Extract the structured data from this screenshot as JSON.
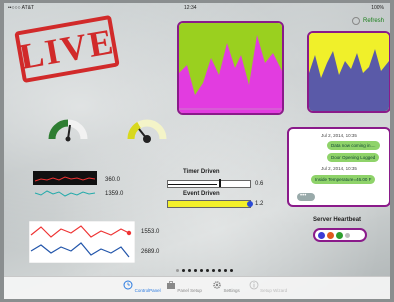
{
  "status": {
    "carrier": "••○○○ AT&T",
    "time": "12:34",
    "battery": "100%"
  },
  "header": {
    "refresh_label": "Refresh"
  },
  "stamp": {
    "text": "LIVE"
  },
  "gauges": [
    {
      "value": 0.45,
      "color": "#2e7d32"
    },
    {
      "value": 0.3,
      "color": "#cccc22"
    }
  ],
  "timer_driven": {
    "title": "Timer Driven",
    "value": "0.6",
    "fill": 0.6
  },
  "event_driven": {
    "title": "Event Driven",
    "value": "1.2",
    "fill": 1.0
  },
  "sparklines": [
    {
      "value": "360.0"
    },
    {
      "value": "1359.0"
    }
  ],
  "lines": [
    {
      "value": "1553.0"
    },
    {
      "value": "2689.0"
    }
  ],
  "chat": {
    "timestamp1": "Jul 2, 2014, 10:35",
    "m1": "Data now coming in....",
    "m2": "Door Opening Logged",
    "timestamp2": "Jul 2, 2014, 10:35",
    "m3": "Inside Temperature=46.00 F",
    "typing": "•••"
  },
  "heartbeat": {
    "title": "Server Heartbeat",
    "colors": [
      "#3b3bd6",
      "#e05a1e",
      "#2e9e2e",
      "#bdbdbd"
    ]
  },
  "pager": {
    "total": 10,
    "active": 1
  },
  "tabs": [
    {
      "label": "ControlPanel",
      "active": true,
      "icon": "clock-icon"
    },
    {
      "label": "Panel Setup",
      "active": false,
      "icon": "toolbox-icon"
    },
    {
      "label": "Settings",
      "active": false,
      "icon": "gear-icon"
    },
    {
      "label": "Setup Wizard",
      "active": false,
      "icon": "info-icon"
    }
  ]
}
